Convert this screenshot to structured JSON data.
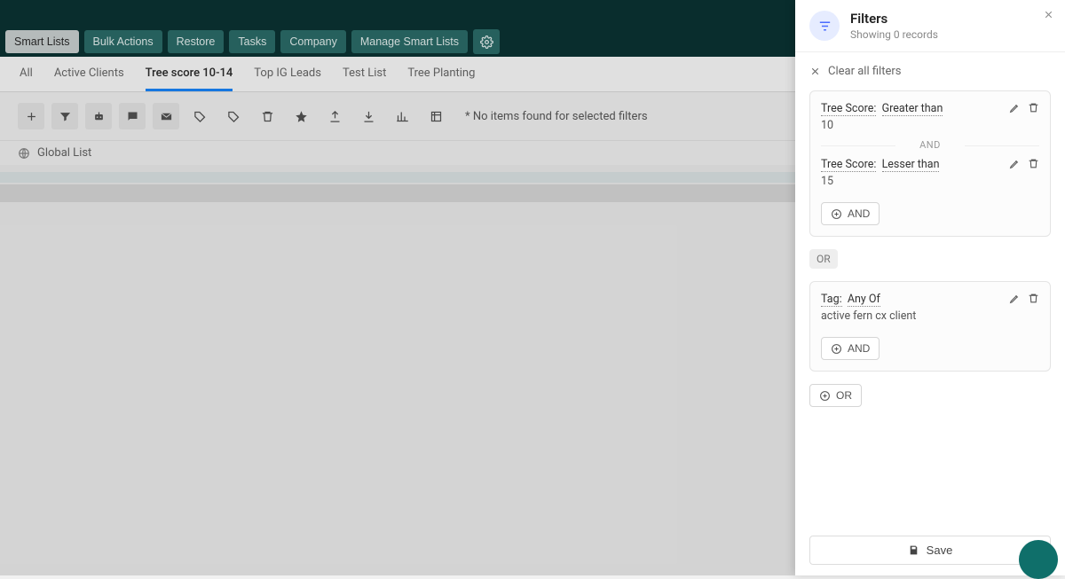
{
  "nav": {
    "smartLists": "Smart Lists",
    "bulkActions": "Bulk Actions",
    "restore": "Restore",
    "tasks": "Tasks",
    "company": "Company",
    "manageSmartLists": "Manage Smart Lists"
  },
  "subtabs": {
    "all": "All",
    "activeClients": "Active Clients",
    "treeScore": "Tree score 10-14",
    "topIgLeads": "Top IG Leads",
    "testList": "Test List",
    "treePlanting": "Tree Planting"
  },
  "toolbar": {
    "noItems": "* No items found for selected filters",
    "columns": "Columns"
  },
  "listRow": {
    "globalList": "Global List"
  },
  "panel": {
    "title": "Filters",
    "subtitle": "Showing 0 records",
    "clearAll": "Clear all filters",
    "group1": {
      "cond1": {
        "field": "Tree Score:",
        "op": "Greater than",
        "val": "10"
      },
      "andSep": "AND",
      "cond2": {
        "field": "Tree Score:",
        "op": "Lesser than",
        "val": "15"
      },
      "addAnd": "AND"
    },
    "orPill": "OR",
    "group2": {
      "cond1": {
        "field": "Tag:",
        "op": "Any Of",
        "val": "active fern cx client"
      },
      "addAnd": "AND"
    },
    "addOr": "OR",
    "save": "Save"
  }
}
